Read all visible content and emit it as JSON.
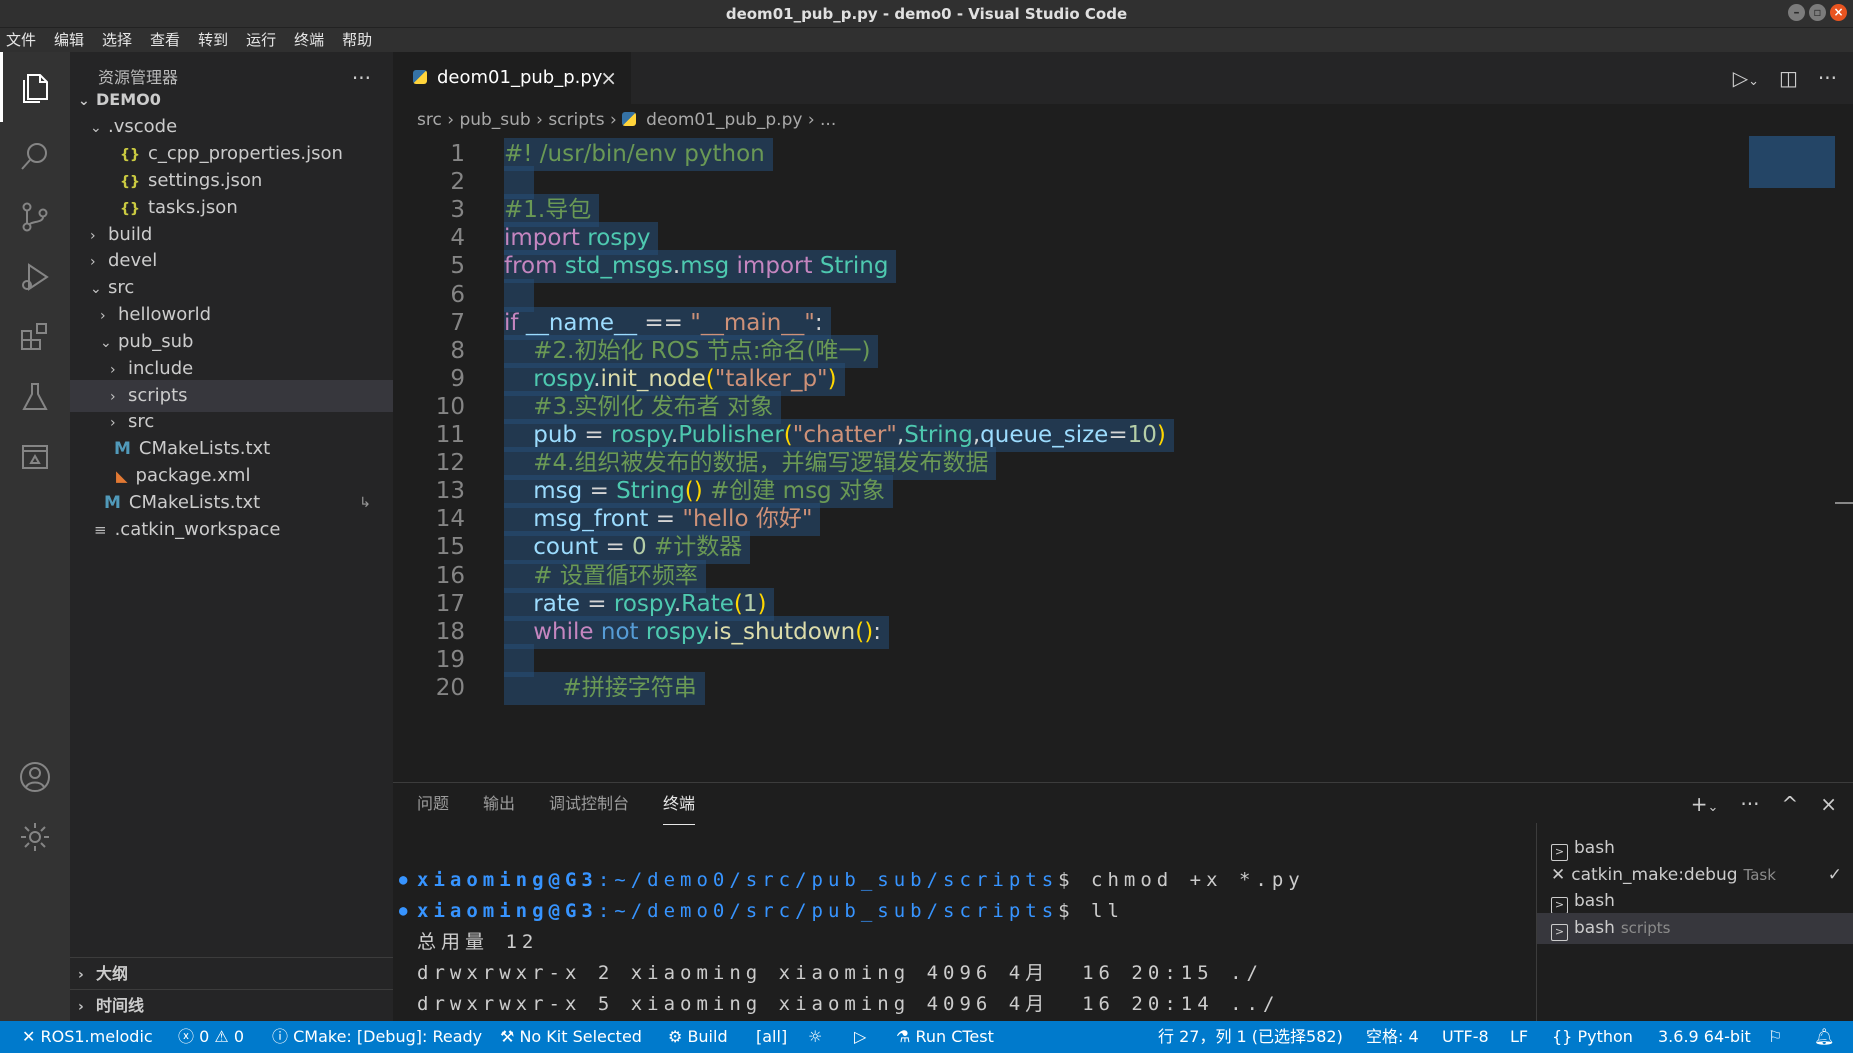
{
  "window": {
    "title": "deom01_pub_p.py - demo0 - Visual Studio Code"
  },
  "menu": [
    "文件",
    "编辑",
    "选择",
    "查看",
    "转到",
    "运行",
    "终端",
    "帮助"
  ],
  "sidebar": {
    "title": "资源管理器",
    "root": "DEMO0",
    "tree": [
      {
        "label": ".vscode",
        "kind": "folder-open"
      },
      {
        "label": "c_cpp_properties.json",
        "kind": "json"
      },
      {
        "label": "settings.json",
        "kind": "json"
      },
      {
        "label": "tasks.json",
        "kind": "json"
      },
      {
        "label": "build",
        "kind": "folder"
      },
      {
        "label": "devel",
        "kind": "folder"
      },
      {
        "label": "src",
        "kind": "folder-open"
      },
      {
        "label": "helloworld",
        "kind": "folder"
      },
      {
        "label": "pub_sub",
        "kind": "folder-open"
      },
      {
        "label": "include",
        "kind": "folder"
      },
      {
        "label": "scripts",
        "kind": "folder",
        "selected": true
      },
      {
        "label": "src",
        "kind": "folder"
      },
      {
        "label": "CMakeLists.txt",
        "kind": "cmake"
      },
      {
        "label": "package.xml",
        "kind": "xml"
      },
      {
        "label": "CMakeLists.txt",
        "kind": "cmake"
      },
      {
        "label": ".catkin_workspace",
        "kind": "file"
      }
    ],
    "outline": "大纲",
    "timeline": "时间线"
  },
  "editor": {
    "tab": "deom01_pub_p.py",
    "breadcrumb": [
      "src",
      "pub_sub",
      "scripts",
      "deom01_pub_p.py",
      "..."
    ]
  },
  "code": [
    {
      "n": "1",
      "text": "#! /usr/bin/env python"
    },
    {
      "n": "2",
      "text": ""
    },
    {
      "n": "3",
      "text": "#1.导包"
    },
    {
      "n": "4",
      "text": "import rospy"
    },
    {
      "n": "5",
      "text": "from std_msgs.msg import String"
    },
    {
      "n": "6",
      "text": ""
    },
    {
      "n": "7",
      "text": "if __name__ == \"__main__\":"
    },
    {
      "n": "8",
      "text": "    #2.初始化 ROS 节点:命名(唯一)"
    },
    {
      "n": "9",
      "text": "    rospy.init_node(\"talker_p\")"
    },
    {
      "n": "10",
      "text": "    #3.实例化 发布者 对象"
    },
    {
      "n": "11",
      "text": "    pub = rospy.Publisher(\"chatter\",String,queue_size=10)"
    },
    {
      "n": "12",
      "text": "    #4.组织被发布的数据，并编写逻辑发布数据"
    },
    {
      "n": "13",
      "text": "    msg = String() #创建 msg 对象"
    },
    {
      "n": "14",
      "text": "    msg_front = \"hello 你好\""
    },
    {
      "n": "15",
      "text": "    count = 0 #计数器"
    },
    {
      "n": "16",
      "text": "    # 设置循环频率"
    },
    {
      "n": "17",
      "text": "    rate = rospy.Rate(1)"
    },
    {
      "n": "18",
      "text": "    while not rospy.is_shutdown():"
    },
    {
      "n": "19",
      "text": ""
    },
    {
      "n": "20",
      "text": "        #拼接字符串"
    }
  ],
  "panel": {
    "tabs": [
      "问题",
      "输出",
      "调试控制台",
      "终端"
    ],
    "active_tab": "终端"
  },
  "terminal": {
    "prompt_user": "xiaoming@G3",
    "prompt_path": ":~/demo0/src/pub_sub/scripts",
    "lines": [
      {
        "type": "prompt",
        "cmd": "$ chmod +x *.py"
      },
      {
        "type": "prompt",
        "cmd": "$ ll"
      },
      {
        "type": "out",
        "text": "总用量 12"
      },
      {
        "type": "out",
        "text": "drwxrwxr-x 2 xiaoming xiaoming 4096 4月  16 20:15 ./"
      },
      {
        "type": "out",
        "text": "drwxrwxr-x 5 xiaoming xiaoming 4096 4月  16 20:14 ../"
      }
    ],
    "instances": [
      {
        "label": "bash",
        "detail": ""
      },
      {
        "label": "catkin_make:debug",
        "detail": "Task"
      },
      {
        "label": "bash",
        "detail": ""
      },
      {
        "label": "bash",
        "detail": "scripts",
        "selected": true
      }
    ]
  },
  "status": {
    "remote": "ROS1.melodic",
    "errors": "0",
    "warnings": "0",
    "cmake": "CMake: [Debug]: Ready",
    "kit": "No Kit Selected",
    "build": "Build",
    "target": "[all]",
    "ctest": "Run CTest",
    "position": "行 27，列 1 (已选择582)",
    "spaces": "空格: 4",
    "encoding": "UTF-8",
    "eol": "LF",
    "language": "Python",
    "interpreter": "3.6.9 64-bit"
  }
}
